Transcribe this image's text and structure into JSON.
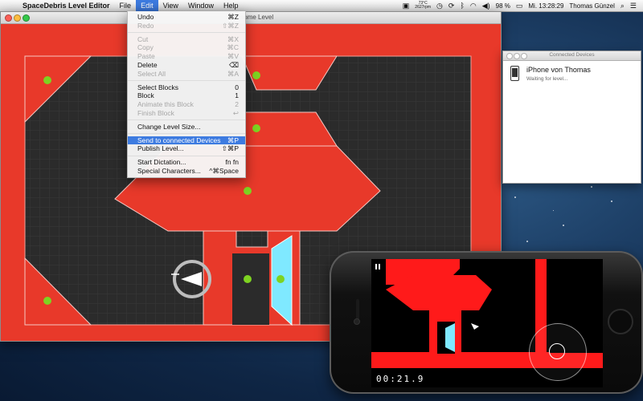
{
  "menubar": {
    "app_name": "SpaceDebris Level Editor",
    "menus": [
      "File",
      "Edit",
      "View",
      "Window",
      "Help"
    ],
    "active_menu": "Edit",
    "status": {
      "temp": "73°C",
      "rpm": "2627rpm",
      "battery": "98 %",
      "datetime": "Mi. 13:28:29",
      "user": "Thomas Günzel"
    }
  },
  "editor_window": {
    "title": "Awesome Level"
  },
  "edit_menu": {
    "groups": [
      [
        {
          "label": "Undo",
          "shortcut": "⌘Z",
          "enabled": true
        },
        {
          "label": "Redo",
          "shortcut": "⇧⌘Z",
          "enabled": false
        }
      ],
      [
        {
          "label": "Cut",
          "shortcut": "⌘X",
          "enabled": false
        },
        {
          "label": "Copy",
          "shortcut": "⌘C",
          "enabled": false
        },
        {
          "label": "Paste",
          "shortcut": "⌘V",
          "enabled": false
        },
        {
          "label": "Delete",
          "shortcut": "⌫",
          "enabled": true
        },
        {
          "label": "Select All",
          "shortcut": "⌘A",
          "enabled": false
        }
      ],
      [
        {
          "label": "Select Blocks",
          "shortcut": "0",
          "enabled": true
        },
        {
          "label": "Block",
          "shortcut": "1",
          "enabled": true
        },
        {
          "label": "Animate this Block",
          "shortcut": "2",
          "enabled": false
        },
        {
          "label": "Finish Block",
          "shortcut": "↩",
          "enabled": false
        }
      ],
      [
        {
          "label": "Change Level Size...",
          "shortcut": "",
          "enabled": true
        }
      ],
      [
        {
          "label": "Send to connected Devices",
          "shortcut": "⌘P",
          "enabled": true,
          "highlighted": true
        },
        {
          "label": "Publish Level...",
          "shortcut": "⇧⌘P",
          "enabled": true
        }
      ],
      [
        {
          "label": "Start Dictation...",
          "shortcut": "fn fn",
          "enabled": true
        },
        {
          "label": "Special Characters...",
          "shortcut": "^⌘Space",
          "enabled": true
        }
      ]
    ]
  },
  "devices_window": {
    "title": "Connected Devices",
    "device_name": "iPhone von Thomas",
    "device_status": "Waiting for level..."
  },
  "iphone": {
    "timer": "00:21.9"
  },
  "colors": {
    "wall_red": "#e8392a",
    "floor": "#2b2b2b",
    "goal_cyan": "#7fe9ff",
    "dot_green": "#7ed321",
    "menu_highlight": "#3d7be0"
  }
}
